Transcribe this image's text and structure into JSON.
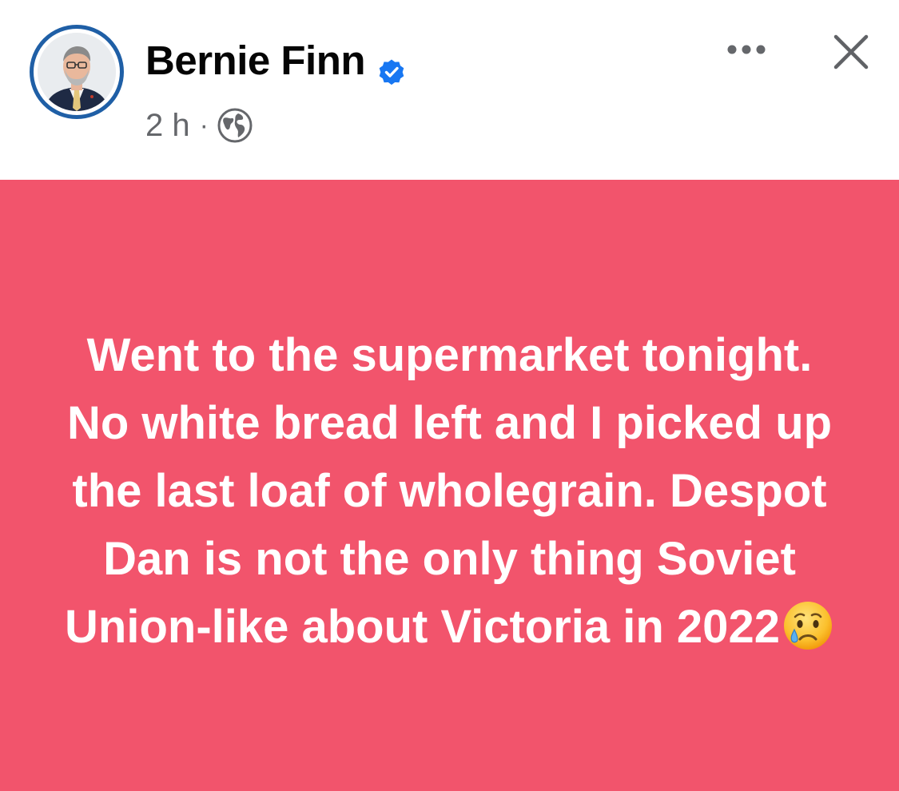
{
  "post": {
    "author": {
      "name": "Bernie Finn",
      "verified": true,
      "verified_color": "#1877f2"
    },
    "meta": {
      "time": "2 h",
      "separator": "·",
      "audience_icon": "globe-icon"
    },
    "actions": {
      "more_icon": "more-horizontal-icon",
      "close_icon": "close-icon"
    },
    "background_color": "#f2546c",
    "text": "Went to the supermarket tonight. No white bread left and I picked up the last loaf of wholegrain. Despot Dan is not the only thing Soviet Union-like about Victoria in 2022",
    "emoji": "crying-face-emoji"
  }
}
